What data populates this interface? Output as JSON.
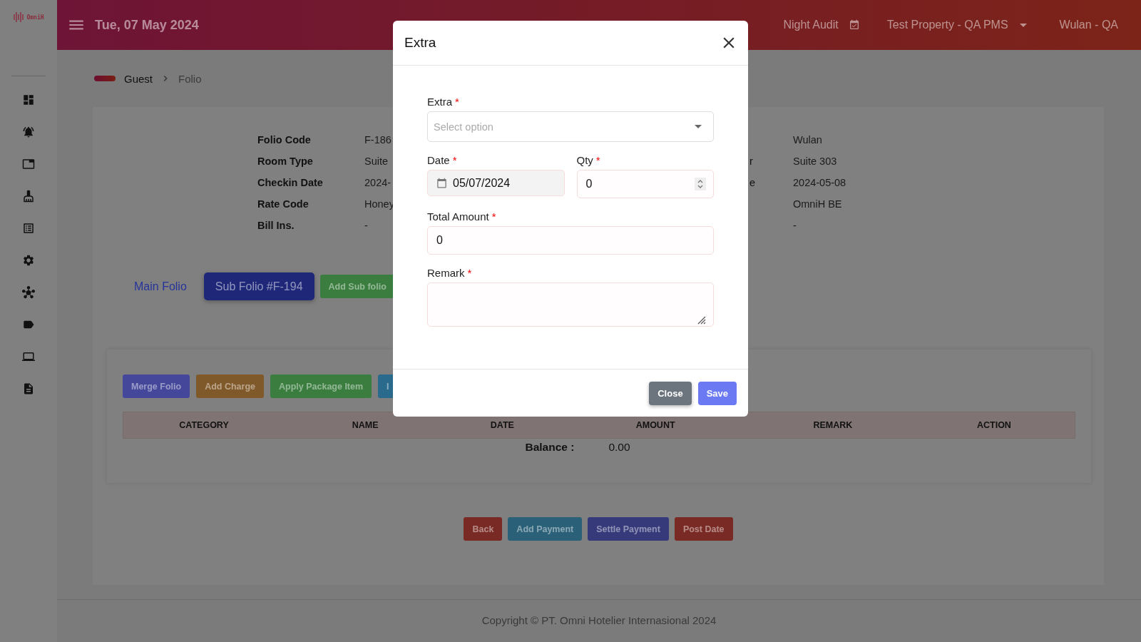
{
  "brand": {
    "name": "OmniH"
  },
  "sidebar": {
    "items": [
      {
        "kind": "dashboard"
      },
      {
        "kind": "bell"
      },
      {
        "kind": "window"
      },
      {
        "kind": "broom"
      },
      {
        "kind": "list"
      },
      {
        "kind": "settings"
      },
      {
        "kind": "network"
      },
      {
        "kind": "tag"
      },
      {
        "kind": "laptop"
      },
      {
        "kind": "document"
      }
    ]
  },
  "header": {
    "date": "Tue, 07 May 2024",
    "night_audit": "Night Audit",
    "property": "Test Property - QA PMS",
    "user": "Wulan - QA"
  },
  "breadcrumb": [
    "Guest",
    "Folio"
  ],
  "folio_info": {
    "left": [
      {
        "label": "Folio Code",
        "value": "F-186"
      },
      {
        "label": "Room Type",
        "value": "Suite"
      },
      {
        "label": "Checkin Date",
        "value": "2024-"
      },
      {
        "label": "Rate Code",
        "value": "Honey"
      },
      {
        "label": "Bill Ins.",
        "value": "-"
      }
    ],
    "right": [
      {
        "value": "Wulan"
      },
      {
        "label": "r",
        "value": "Suite 303"
      },
      {
        "label": "e",
        "value": "2024-05-08"
      },
      {
        "value": "OmniH BE"
      },
      {
        "value": "-"
      }
    ]
  },
  "folio_tabs": [
    {
      "label": "Main Folio",
      "selected": false
    },
    {
      "label": "Sub Folio #F-194",
      "selected": true
    }
  ],
  "add_sub_folio": "Add Sub folio",
  "actions": [
    {
      "label": "Merge Folio",
      "color": "#45489a"
    },
    {
      "label": "Add Charge",
      "color": "#80592a"
    },
    {
      "label": "Apply Package Item",
      "color": "#3a7d3f"
    },
    {
      "label": "I",
      "color": "#2a6a8c"
    }
  ],
  "table": {
    "columns": [
      "CATEGORY",
      "NAME",
      "DATE",
      "AMOUNT",
      "REMARK",
      "ACTION"
    ]
  },
  "balance": {
    "label": "Balance :",
    "value": "0.00"
  },
  "footer_buttons": [
    {
      "label": "Back",
      "color": "#7a2a24"
    },
    {
      "label": "Add Payment",
      "color": "#2a6078"
    },
    {
      "label": "Settle Payment",
      "color": "#363a7a"
    },
    {
      "label": "Post Date",
      "color": "#7a2a24"
    }
  ],
  "copyright": "Copyright © PT. Omni Hotelier Internasional 2024",
  "modal": {
    "title": "Extra",
    "fields": [
      {
        "kind": "select",
        "label": "Extra",
        "required_mark": "*",
        "placeholder": "Select option"
      },
      {
        "kind": "date",
        "label": "Date",
        "required_mark": "*",
        "value": "05/07/2024",
        "disabled": true
      },
      {
        "kind": "number",
        "label": "Qty",
        "required_mark": "*",
        "value": "0"
      },
      {
        "kind": "text",
        "label": "Total Amount",
        "required_mark": "*",
        "value": "0"
      },
      {
        "kind": "textarea",
        "label": "Remark",
        "required_mark": "*"
      }
    ],
    "buttons": [
      {
        "label": "Close",
        "kind": "secondary"
      },
      {
        "label": "Save",
        "kind": "primary"
      }
    ]
  }
}
